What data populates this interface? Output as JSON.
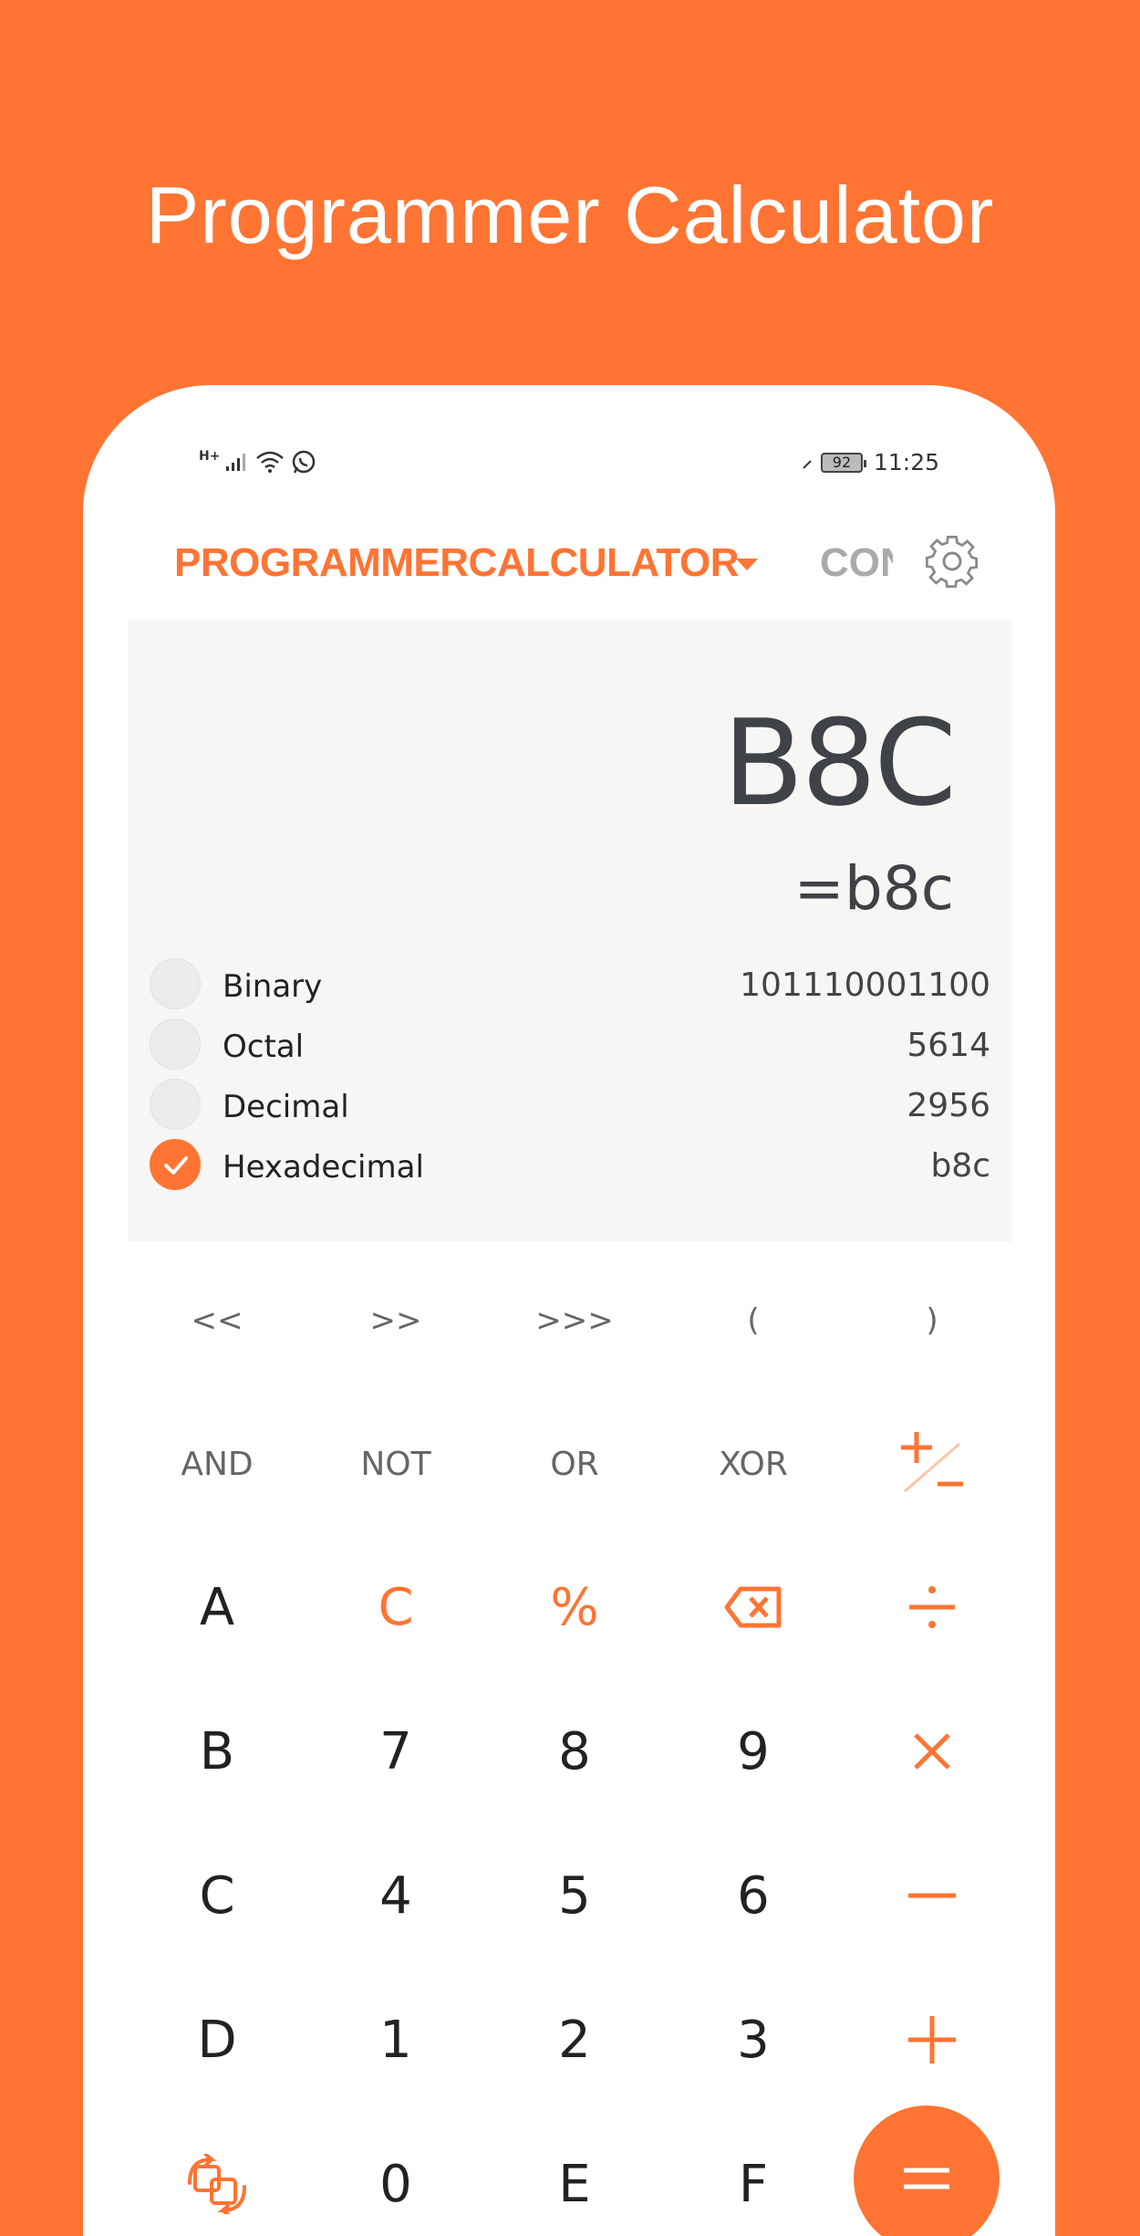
{
  "headline": "Programmer Calculator",
  "status_bar": {
    "network": "H+",
    "battery": "92",
    "time": "11:25"
  },
  "toolbar": {
    "mode": "PROGRAMMERCALCULATOR",
    "next_tab": "CONVERTER"
  },
  "display": {
    "expression": "B8C",
    "result": "=b8c",
    "bases": [
      {
        "label": "Binary",
        "value": "101110001100",
        "checked": false
      },
      {
        "label": "Octal",
        "value": "5614",
        "checked": false
      },
      {
        "label": "Decimal",
        "value": "2956",
        "checked": false
      },
      {
        "label": "Hexadecimal",
        "value": "b8c",
        "checked": true
      }
    ]
  },
  "keypad": {
    "row1": [
      "<<",
      ">>",
      ">>>",
      "(",
      ")"
    ],
    "row2": [
      "AND",
      "NOT",
      "OR",
      "XOR"
    ],
    "row3": [
      "A",
      "C",
      "%"
    ],
    "row4": [
      "B",
      "7",
      "8",
      "9"
    ],
    "row5": [
      "C",
      "4",
      "5",
      "6"
    ],
    "row6": [
      "D",
      "1",
      "2",
      "3"
    ],
    "row7": [
      "0",
      "E",
      "F"
    ]
  },
  "icons": {
    "plus_minus": "plus-minus-icon",
    "backspace": "backspace-icon",
    "divide": "divide-icon",
    "multiply": "multiply-icon",
    "minus": "minus-icon",
    "plus": "plus-icon",
    "convert": "swap-icon",
    "equals": "equals-icon",
    "settings": "gear-icon"
  },
  "colors": {
    "accent": "#FF7433",
    "display_bg": "#F7F6F4"
  }
}
